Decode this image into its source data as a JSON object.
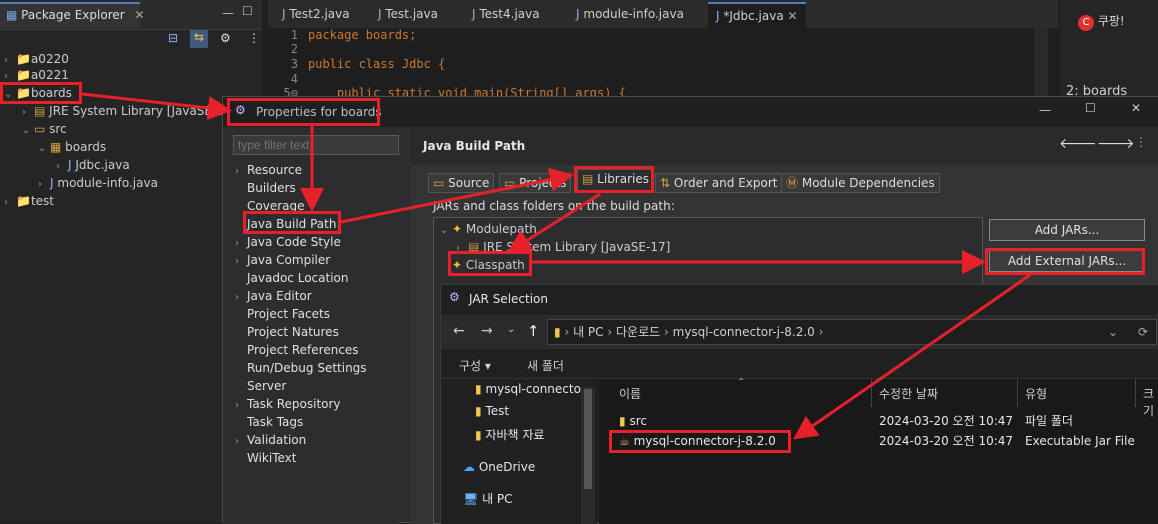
{
  "package_explorer": {
    "tab_title": "Package Explorer",
    "tree": [
      {
        "label": "a0220",
        "level": 0
      },
      {
        "label": "a0221",
        "level": 0
      },
      {
        "label": "boards",
        "level": 0
      },
      {
        "label": "JRE System Library [JavaSE-1",
        "level": 1
      },
      {
        "label": "src",
        "level": 1
      },
      {
        "label": "boards",
        "level": 2
      },
      {
        "label": "Jdbc.java",
        "level": 3
      },
      {
        "label": "module-info.java",
        "level": 2
      },
      {
        "label": "test",
        "level": 0
      }
    ]
  },
  "editor": {
    "tabs": [
      "Test2.java",
      "Test.java",
      "Test4.java",
      "module-info.java",
      "*Jdbc.java"
    ],
    "lines": [
      {
        "n": "1",
        "code": "package boards;"
      },
      {
        "n": "2",
        "code": ""
      },
      {
        "n": "3",
        "code": "public class Jdbc {"
      },
      {
        "n": "4",
        "code": ""
      },
      {
        "n": "5⊖",
        "code": "    public static void main(String[] args) {"
      }
    ]
  },
  "right_ide": {
    "coupang": "쿠팡!",
    "outline_partial": "2: boards"
  },
  "properties_dialog": {
    "title": "Properties for boards",
    "filter_placeholder": "type filter text",
    "nav_items": [
      "Resource",
      "Builders",
      "Coverage",
      "Java Build Path",
      "Java Code Style",
      "Java Compiler",
      "Javadoc Location",
      "Java Editor",
      "Project Facets",
      "Project Natures",
      "Project References",
      "Run/Debug Settings",
      "Server",
      "Task Repository",
      "Task Tags",
      "Validation",
      "WikiText"
    ],
    "page_title": "Java Build Path",
    "subtabs": [
      "Source",
      "Projects",
      "Libraries",
      "Order and Export",
      "Module Dependencies"
    ],
    "build_path_label": "JARs and class folders on the build path:",
    "tree": [
      "Modulepath",
      "JRE System Library [JavaSE-17]",
      "Classpath"
    ],
    "buttons": [
      "Add JARs...",
      "Add External JARs..."
    ]
  },
  "jar_dialog": {
    "title": "JAR Selection",
    "breadcrumb": [
      "내 PC",
      "다운로드",
      "mysql-connector-j-8.2.0"
    ],
    "toolbar": {
      "organize": "구성 ▾",
      "new_folder": "새 폴더"
    },
    "sidebar": [
      "mysql-connecto",
      "Test",
      "자바책 자료",
      "OneDrive",
      "내 PC"
    ],
    "columns": [
      "이름",
      "수정한 날짜",
      "유형",
      "크기"
    ],
    "files": [
      {
        "name": "src",
        "date": "2024-03-20 오전 10:47",
        "type": "파일 폴더"
      },
      {
        "name": "mysql-connector-j-8.2.0",
        "date": "2024-03-20 오전 10:47",
        "type": "Executable Jar File"
      }
    ]
  },
  "colors": {
    "annotation_red": "#e8202a",
    "accent_blue": "#4a7fc1"
  }
}
